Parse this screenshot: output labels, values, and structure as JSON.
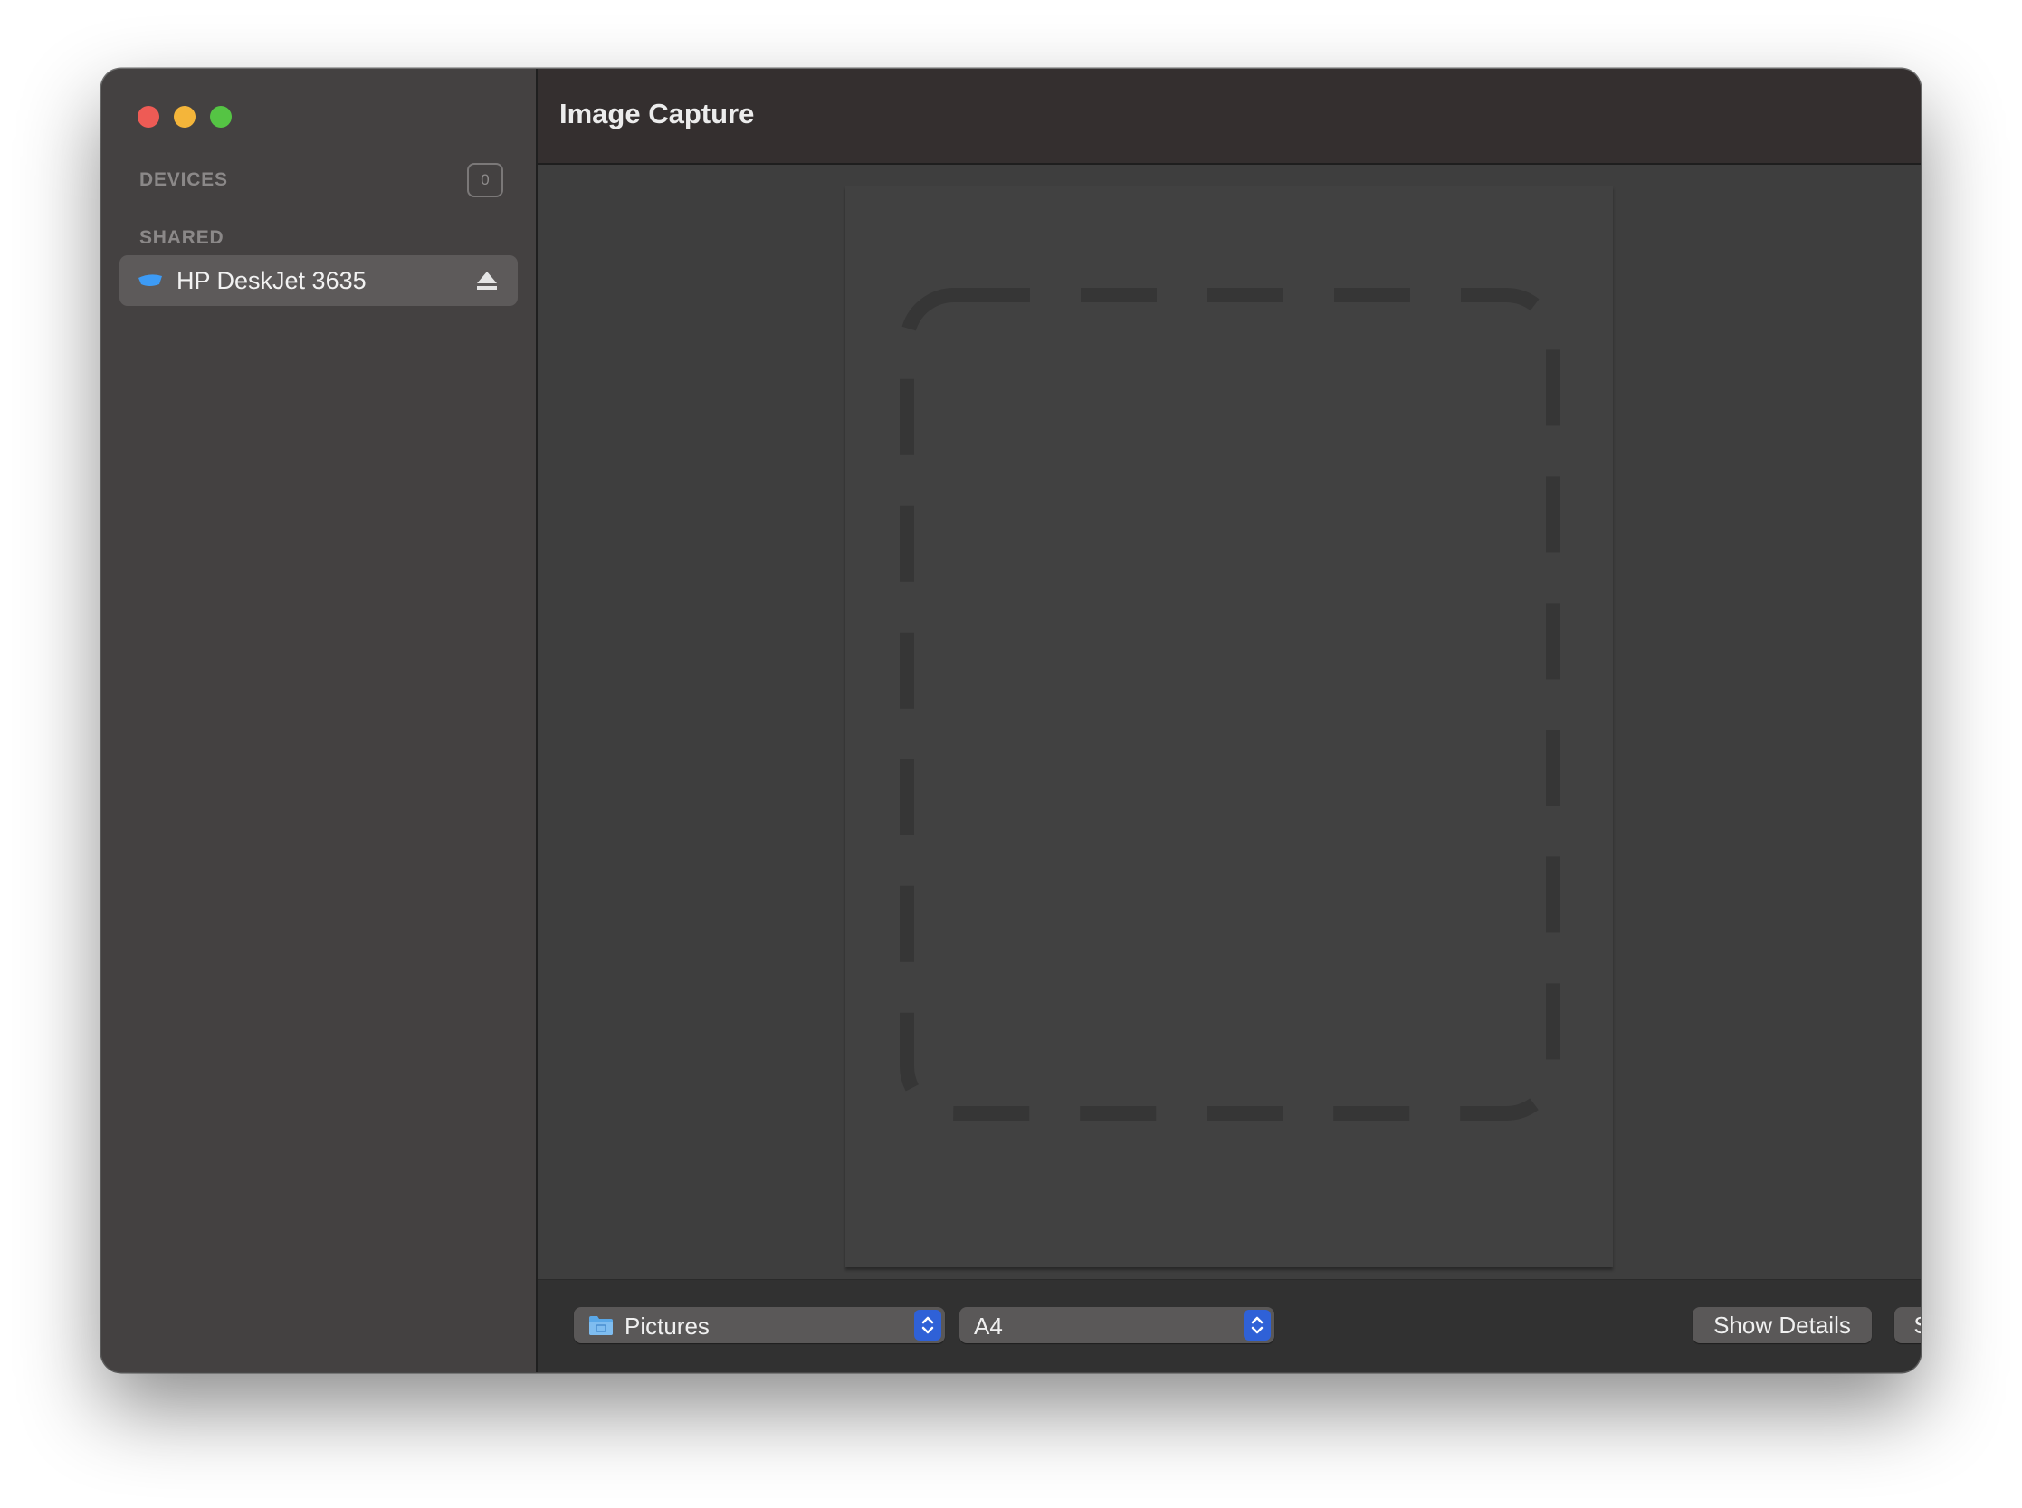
{
  "window": {
    "title": "Image Capture"
  },
  "sidebar": {
    "devices_header": "DEVICES",
    "devices_count": "0",
    "shared_header": "SHARED",
    "shared_items": [
      {
        "label": "HP DeskJet 3635",
        "icon": "printer-icon",
        "action_icon": "eject-icon"
      }
    ]
  },
  "toolbar": {
    "folder_select": {
      "value": "Pictures",
      "icon": "folder-icon"
    },
    "size_select": {
      "value": "A4"
    },
    "show_details_label": "Show Details",
    "scan_label": "Scan"
  },
  "colors": {
    "close": "#ee5b55",
    "minimize": "#f4b53a",
    "zoom": "#55c444",
    "accent": "#2f61d7",
    "device_icon": "#3d9bf5"
  }
}
